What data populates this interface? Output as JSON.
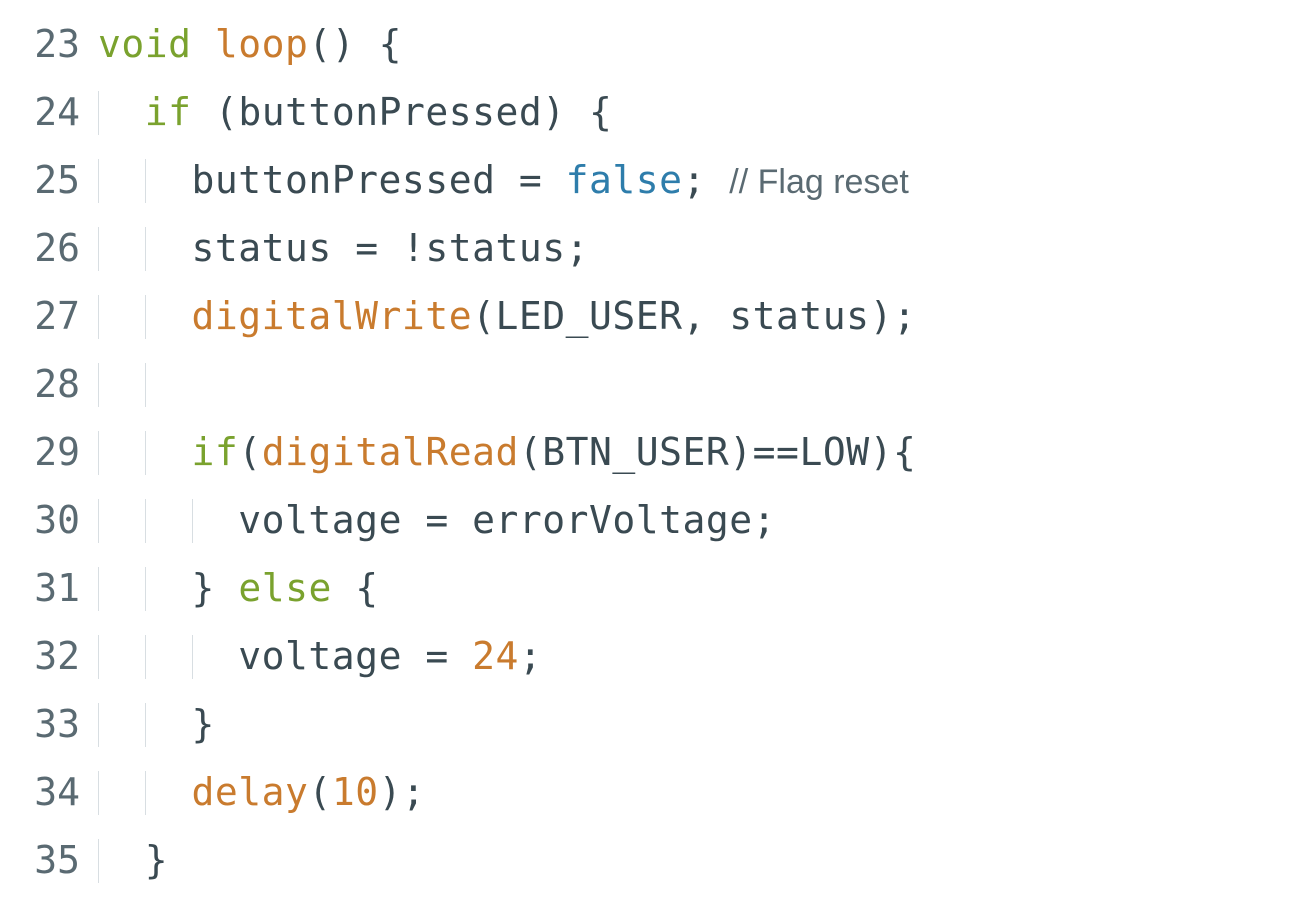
{
  "lines": [
    {
      "num": "23",
      "indent": 0,
      "tokens": [
        {
          "t": "void",
          "c": "tok-keyword"
        },
        {
          "t": " ",
          "c": ""
        },
        {
          "t": "loop",
          "c": "tok-func-def"
        },
        {
          "t": "()",
          "c": "tok-punct"
        },
        {
          "t": " ",
          "c": ""
        },
        {
          "t": "{",
          "c": "tok-punct"
        }
      ]
    },
    {
      "num": "24",
      "indent": 1,
      "tokens": [
        {
          "t": "if",
          "c": "tok-keyword"
        },
        {
          "t": " ",
          "c": ""
        },
        {
          "t": "(",
          "c": "tok-punct"
        },
        {
          "t": "buttonPressed",
          "c": "tok-ident"
        },
        {
          "t": ")",
          "c": "tok-punct"
        },
        {
          "t": " ",
          "c": ""
        },
        {
          "t": "{",
          "c": "tok-punct"
        }
      ]
    },
    {
      "num": "25",
      "indent": 2,
      "tokens": [
        {
          "t": "buttonPressed",
          "c": "tok-ident"
        },
        {
          "t": " ",
          "c": ""
        },
        {
          "t": "=",
          "c": "tok-op"
        },
        {
          "t": " ",
          "c": ""
        },
        {
          "t": "false",
          "c": "tok-literal-kw"
        },
        {
          "t": ";",
          "c": "tok-punct"
        },
        {
          "t": " ",
          "c": ""
        },
        {
          "t": "// Flag reset",
          "c": "tok-comment"
        }
      ]
    },
    {
      "num": "26",
      "indent": 2,
      "tokens": [
        {
          "t": "status",
          "c": "tok-ident"
        },
        {
          "t": " ",
          "c": ""
        },
        {
          "t": "=",
          "c": "tok-op"
        },
        {
          "t": " ",
          "c": ""
        },
        {
          "t": "!",
          "c": "tok-op"
        },
        {
          "t": "status",
          "c": "tok-ident"
        },
        {
          "t": ";",
          "c": "tok-punct"
        }
      ]
    },
    {
      "num": "27",
      "indent": 2,
      "tokens": [
        {
          "t": "digitalWrite",
          "c": "tok-func-call"
        },
        {
          "t": "(",
          "c": "tok-punct"
        },
        {
          "t": "LED_USER",
          "c": "tok-const"
        },
        {
          "t": ",",
          "c": "tok-punct"
        },
        {
          "t": " ",
          "c": ""
        },
        {
          "t": "status",
          "c": "tok-ident"
        },
        {
          "t": ")",
          "c": "tok-punct"
        },
        {
          "t": ";",
          "c": "tok-punct"
        }
      ]
    },
    {
      "num": "28",
      "indent": 2,
      "tokens": []
    },
    {
      "num": "29",
      "indent": 2,
      "tokens": [
        {
          "t": "if",
          "c": "tok-keyword"
        },
        {
          "t": "(",
          "c": "tok-punct"
        },
        {
          "t": "digitalRead",
          "c": "tok-func-call"
        },
        {
          "t": "(",
          "c": "tok-punct"
        },
        {
          "t": "BTN_USER",
          "c": "tok-const"
        },
        {
          "t": ")",
          "c": "tok-punct"
        },
        {
          "t": "==",
          "c": "tok-op"
        },
        {
          "t": "LOW",
          "c": "tok-const"
        },
        {
          "t": ")",
          "c": "tok-punct"
        },
        {
          "t": "{",
          "c": "tok-punct"
        }
      ]
    },
    {
      "num": "30",
      "indent": 3,
      "tokens": [
        {
          "t": "voltage",
          "c": "tok-ident"
        },
        {
          "t": " ",
          "c": ""
        },
        {
          "t": "=",
          "c": "tok-op"
        },
        {
          "t": " ",
          "c": ""
        },
        {
          "t": "errorVoltage",
          "c": "tok-ident"
        },
        {
          "t": ";",
          "c": "tok-punct"
        }
      ]
    },
    {
      "num": "31",
      "indent": 2,
      "tokens": [
        {
          "t": "}",
          "c": "tok-punct"
        },
        {
          "t": " ",
          "c": ""
        },
        {
          "t": "else",
          "c": "tok-keyword"
        },
        {
          "t": " ",
          "c": ""
        },
        {
          "t": "{",
          "c": "tok-punct"
        }
      ]
    },
    {
      "num": "32",
      "indent": 3,
      "tokens": [
        {
          "t": "voltage",
          "c": "tok-ident"
        },
        {
          "t": " ",
          "c": ""
        },
        {
          "t": "=",
          "c": "tok-op"
        },
        {
          "t": " ",
          "c": ""
        },
        {
          "t": "24",
          "c": "tok-number"
        },
        {
          "t": ";",
          "c": "tok-punct"
        }
      ]
    },
    {
      "num": "33",
      "indent": 2,
      "tokens": [
        {
          "t": "}",
          "c": "tok-punct"
        }
      ]
    },
    {
      "num": "34",
      "indent": 2,
      "tokens": [
        {
          "t": "delay",
          "c": "tok-func-call"
        },
        {
          "t": "(",
          "c": "tok-punct"
        },
        {
          "t": "10",
          "c": "tok-number"
        },
        {
          "t": ")",
          "c": "tok-punct"
        },
        {
          "t": ";",
          "c": "tok-punct"
        }
      ]
    },
    {
      "num": "35",
      "indent": 1,
      "tokens": [
        {
          "t": "}",
          "c": "tok-punct"
        }
      ]
    }
  ],
  "indent_unit": "  "
}
